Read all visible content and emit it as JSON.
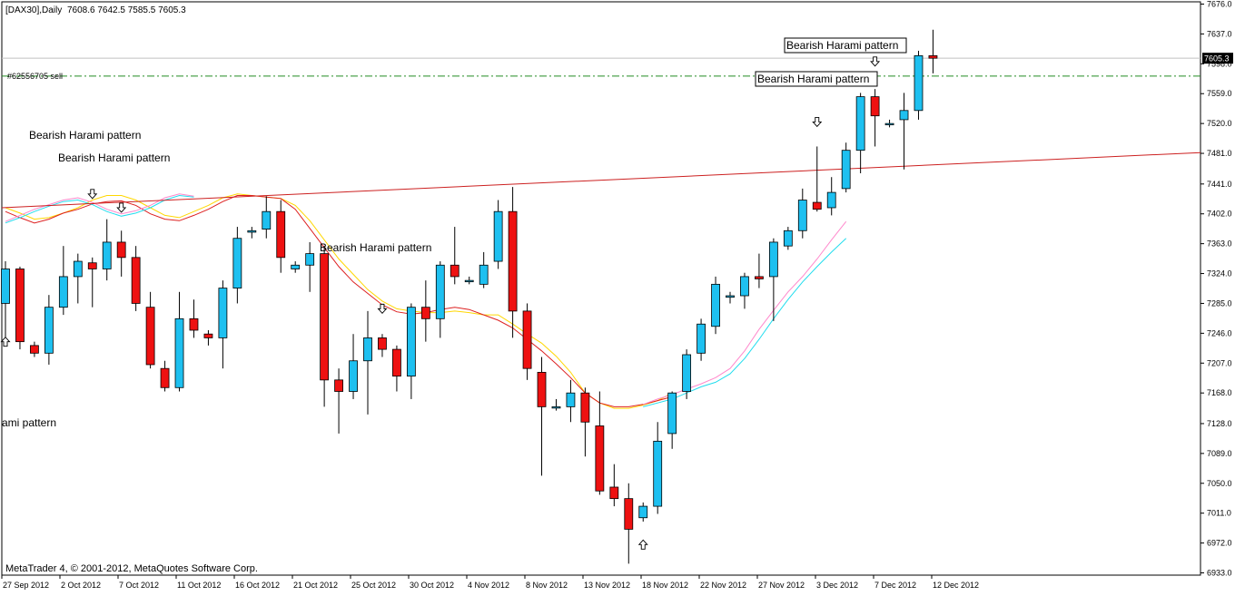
{
  "header": {
    "symbol": "[DAX30],Daily",
    "ohlc": "7608.6 7642.5 7585.5 7605.3"
  },
  "footer": {
    "copyright": "MetaTrader 4, © 2001-2012, MetaQuotes Software Corp."
  },
  "order_line": {
    "label": "#62556705 sell",
    "price": 7582,
    "color": "#228b22"
  },
  "current_price": {
    "label": "7605.3",
    "value": 7605.3
  },
  "colors": {
    "bull": "#1ec0f0",
    "bear": "#ee1111",
    "ma_yellow": "#ffd700",
    "ma_red": "#dd2020",
    "ma_cyan": "#22ddee",
    "ma_pink": "#ff88cc",
    "trendline": "#cc2020"
  },
  "annotations": [
    {
      "text": "Bearish Harami pattern",
      "boxed": true
    },
    {
      "text": "Bearish Harami pattern",
      "boxed": true
    },
    {
      "text": "Bearish Harami pattern",
      "boxed": false
    },
    {
      "text": "Bearish Harami pattern",
      "boxed": false
    },
    {
      "text": "Bearish Harami pattern",
      "boxed": false
    },
    {
      "text": "ami pattern",
      "boxed": false
    }
  ],
  "chart_data": {
    "type": "candlestick",
    "y_ticks": [
      7676.0,
      7637.0,
      7598.0,
      7559.0,
      7520.0,
      7481.0,
      7441.0,
      7402.0,
      7363.0,
      7324.0,
      7285.0,
      7246.0,
      7207.0,
      7168.0,
      7128.0,
      7089.0,
      7050.0,
      7011.0,
      6972.0,
      6933.0
    ],
    "ylim": [
      6933.0,
      7676.0
    ],
    "x_labels": [
      "27 Sep 2012",
      "2 Oct 2012",
      "7 Oct 2012",
      "11 Oct 2012",
      "16 Oct 2012",
      "21 Oct 2012",
      "25 Oct 2012",
      "30 Oct 2012",
      "4 Nov 2012",
      "8 Nov 2012",
      "13 Nov 2012",
      "18 Nov 2012",
      "22 Nov 2012",
      "27 Nov 2012",
      "3 Dec 2012",
      "7 Dec 2012",
      "12 Dec 2012"
    ],
    "candles": [
      {
        "o": 7285,
        "h": 7340,
        "l": 7240,
        "c": 7330
      },
      {
        "o": 7330,
        "h": 7333,
        "l": 7225,
        "c": 7235
      },
      {
        "o": 7230,
        "h": 7235,
        "l": 7215,
        "c": 7220
      },
      {
        "o": 7220,
        "h": 7296,
        "l": 7205,
        "c": 7280
      },
      {
        "o": 7280,
        "h": 7360,
        "l": 7270,
        "c": 7320
      },
      {
        "o": 7320,
        "h": 7350,
        "l": 7285,
        "c": 7340
      },
      {
        "o": 7338,
        "h": 7345,
        "l": 7280,
        "c": 7330
      },
      {
        "o": 7330,
        "h": 7395,
        "l": 7315,
        "c": 7365
      },
      {
        "o": 7365,
        "h": 7380,
        "l": 7320,
        "c": 7345
      },
      {
        "o": 7345,
        "h": 7360,
        "l": 7275,
        "c": 7285
      },
      {
        "o": 7280,
        "h": 7300,
        "l": 7200,
        "c": 7205
      },
      {
        "o": 7200,
        "h": 7210,
        "l": 7170,
        "c": 7175
      },
      {
        "o": 7175,
        "h": 7300,
        "l": 7170,
        "c": 7265
      },
      {
        "o": 7265,
        "h": 7290,
        "l": 7240,
        "c": 7250
      },
      {
        "o": 7245,
        "h": 7250,
        "l": 7230,
        "c": 7240
      },
      {
        "o": 7240,
        "h": 7315,
        "l": 7200,
        "c": 7305
      },
      {
        "o": 7305,
        "h": 7385,
        "l": 7285,
        "c": 7370
      },
      {
        "o": 7378,
        "h": 7385,
        "l": 7370,
        "c": 7380
      },
      {
        "o": 7382,
        "h": 7425,
        "l": 7370,
        "c": 7405
      },
      {
        "o": 7405,
        "h": 7420,
        "l": 7325,
        "c": 7345
      },
      {
        "o": 7330,
        "h": 7340,
        "l": 7325,
        "c": 7335
      },
      {
        "o": 7335,
        "h": 7365,
        "l": 7300,
        "c": 7350
      },
      {
        "o": 7350,
        "h": 7360,
        "l": 7150,
        "c": 7185
      },
      {
        "o": 7185,
        "h": 7200,
        "l": 7115,
        "c": 7170
      },
      {
        "o": 7170,
        "h": 7245,
        "l": 7160,
        "c": 7210
      },
      {
        "o": 7210,
        "h": 7275,
        "l": 7140,
        "c": 7240
      },
      {
        "o": 7240,
        "h": 7245,
        "l": 7215,
        "c": 7225
      },
      {
        "o": 7225,
        "h": 7230,
        "l": 7170,
        "c": 7190
      },
      {
        "o": 7190,
        "h": 7285,
        "l": 7160,
        "c": 7280
      },
      {
        "o": 7280,
        "h": 7315,
        "l": 7235,
        "c": 7265
      },
      {
        "o": 7265,
        "h": 7340,
        "l": 7240,
        "c": 7335
      },
      {
        "o": 7335,
        "h": 7385,
        "l": 7310,
        "c": 7320
      },
      {
        "o": 7315,
        "h": 7320,
        "l": 7310,
        "c": 7315
      },
      {
        "o": 7310,
        "h": 7352,
        "l": 7305,
        "c": 7335
      },
      {
        "o": 7340,
        "h": 7420,
        "l": 7330,
        "c": 7405
      },
      {
        "o": 7405,
        "h": 7437,
        "l": 7240,
        "c": 7275
      },
      {
        "o": 7275,
        "h": 7285,
        "l": 7185,
        "c": 7200
      },
      {
        "o": 7195,
        "h": 7215,
        "l": 7060,
        "c": 7150
      },
      {
        "o": 7150,
        "h": 7160,
        "l": 7145,
        "c": 7150
      },
      {
        "o": 7150,
        "h": 7185,
        "l": 7130,
        "c": 7168
      },
      {
        "o": 7168,
        "h": 7175,
        "l": 7085,
        "c": 7130
      },
      {
        "o": 7125,
        "h": 7170,
        "l": 7035,
        "c": 7040
      },
      {
        "o": 7045,
        "h": 7075,
        "l": 7020,
        "c": 7030
      },
      {
        "o": 7030,
        "h": 7050,
        "l": 6945,
        "c": 6990
      },
      {
        "o": 7005,
        "h": 7025,
        "l": 7000,
        "c": 7020
      },
      {
        "o": 7020,
        "h": 7130,
        "l": 7010,
        "c": 7105
      },
      {
        "o": 7115,
        "h": 7170,
        "l": 7095,
        "c": 7168
      },
      {
        "o": 7170,
        "h": 7225,
        "l": 7160,
        "c": 7218
      },
      {
        "o": 7220,
        "h": 7265,
        "l": 7210,
        "c": 7258
      },
      {
        "o": 7255,
        "h": 7320,
        "l": 7245,
        "c": 7310
      },
      {
        "o": 7293,
        "h": 7300,
        "l": 7285,
        "c": 7295
      },
      {
        "o": 7295,
        "h": 7325,
        "l": 7278,
        "c": 7320
      },
      {
        "o": 7320,
        "h": 7350,
        "l": 7305,
        "c": 7317
      },
      {
        "o": 7320,
        "h": 7370,
        "l": 7262,
        "c": 7365
      },
      {
        "o": 7360,
        "h": 7385,
        "l": 7355,
        "c": 7380
      },
      {
        "o": 7380,
        "h": 7435,
        "l": 7370,
        "c": 7420
      },
      {
        "o": 7417,
        "h": 7490,
        "l": 7405,
        "c": 7408
      },
      {
        "o": 7410,
        "h": 7450,
        "l": 7400,
        "c": 7430
      },
      {
        "o": 7435,
        "h": 7495,
        "l": 7430,
        "c": 7485
      },
      {
        "o": 7485,
        "h": 7560,
        "l": 7455,
        "c": 7555
      },
      {
        "o": 7555,
        "h": 7565,
        "l": 7490,
        "c": 7530
      },
      {
        "o": 7520,
        "h": 7525,
        "l": 7515,
        "c": 7520
      },
      {
        "o": 7525,
        "h": 7560,
        "l": 7460,
        "c": 7537
      },
      {
        "o": 7537,
        "h": 7615,
        "l": 7525,
        "c": 7608.6
      },
      {
        "o": 7608.6,
        "h": 7642.5,
        "l": 7585.5,
        "c": 7605.3
      }
    ],
    "moving_averages": [
      {
        "color": "#ffd700",
        "values": [
          7410,
          7403,
          7395,
          7397,
          7403,
          7410,
          7420,
          7426,
          7426,
          7420,
          7410,
          7400,
          7397,
          7405,
          7413,
          7423,
          7428,
          7426,
          7424,
          7422,
          7413,
          7393,
          7368,
          7343,
          7323,
          7303,
          7288,
          7278,
          7275,
          7273,
          7273,
          7275,
          7273,
          7270,
          7270,
          7258,
          7245,
          7233,
          7216,
          7195,
          7168,
          7155,
          7148,
          7148,
          7152,
          7158,
          7168,
          null
        ]
      },
      {
        "color": "#dd2020",
        "values": [
          7405,
          7397,
          7390,
          7395,
          7403,
          7408,
          7415,
          7418,
          7419,
          7413,
          7402,
          7395,
          7393,
          7400,
          7408,
          7418,
          7426,
          7426,
          7424,
          7422,
          7408,
          7383,
          7358,
          7333,
          7313,
          7298,
          7283,
          7274,
          7271,
          7273,
          7277,
          7280,
          7277,
          7270,
          7263,
          7253,
          7238,
          7223,
          7206,
          7188,
          7168,
          7155,
          7150,
          7150,
          7153,
          7158,
          7163,
          null
        ]
      },
      {
        "color": "#22ddee",
        "values": [
          7390,
          7397,
          7405,
          7412,
          7418,
          7420,
          7414,
          7405,
          7399,
          7403,
          7410,
          7420,
          7426,
          7424,
          null,
          null,
          null,
          null,
          null,
          null,
          null,
          null,
          null,
          null,
          null,
          null,
          null,
          null,
          null,
          null,
          null,
          null,
          null,
          null,
          null,
          null,
          null,
          null,
          null,
          null,
          null,
          null,
          null,
          null,
          7150,
          7155,
          7160,
          7168,
          7176,
          7182,
          7193,
          7213,
          7238,
          7265,
          7290,
          7313,
          7333,
          7352,
          7370
        ]
      },
      {
        "color": "#ff88cc",
        "values": [
          7392,
          7400,
          7408,
          7414,
          7420,
          7423,
          7417,
          7408,
          7402,
          7406,
          7413,
          7423,
          7428,
          7425,
          null,
          null,
          null,
          null,
          null,
          null,
          null,
          null,
          null,
          null,
          null,
          null,
          null,
          null,
          null,
          null,
          null,
          null,
          null,
          null,
          null,
          null,
          null,
          null,
          null,
          null,
          null,
          null,
          null,
          null,
          7153,
          7160,
          7166,
          7173,
          7180,
          7188,
          7200,
          7223,
          7251,
          7276,
          7300,
          7320,
          7343,
          7368,
          7392
        ]
      }
    ],
    "trendline": {
      "start": 7410,
      "end": 7482
    },
    "arrows": [
      {
        "dir": "down",
        "price": 7428
      },
      {
        "dir": "down",
        "price": 7410
      },
      {
        "dir": "down",
        "price": 7278
      },
      {
        "dir": "down",
        "price": 7522
      },
      {
        "dir": "down",
        "price": 7601
      },
      {
        "dir": "up",
        "price": 6970
      },
      {
        "dir": "up",
        "price": 7235
      }
    ]
  }
}
